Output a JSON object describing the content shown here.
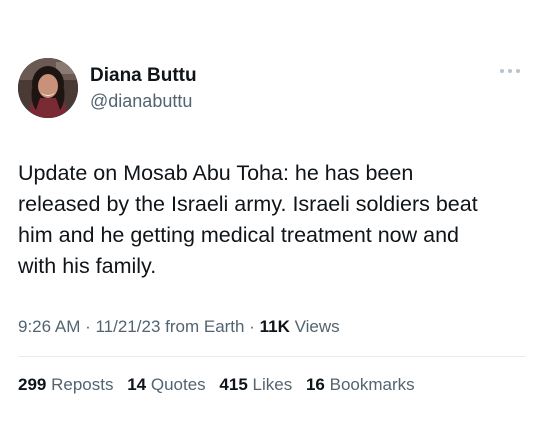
{
  "author": {
    "display_name": "Diana Buttu",
    "handle": "@dianabuttu",
    "avatar_icon": "profile-photo"
  },
  "more_icon": "more-options-icon",
  "tweet": {
    "text_lines": [
      "Update on Mosab Abu Toha: he has been",
      "released by the Israeli army. Israeli soldiers beat",
      "him and he getting medical treatment now and",
      "with his family."
    ]
  },
  "meta": {
    "time": "9:26 AM",
    "sep1": " · ",
    "date": "11/21/23",
    "source": " from Earth",
    "sep2": " · ",
    "views_count": "11K",
    "views_label": " Views"
  },
  "stats": {
    "reposts_count": "299",
    "reposts_label": "Reposts",
    "quotes_count": "14",
    "quotes_label": "Quotes",
    "likes_count": "415",
    "likes_label": "Likes",
    "bookmarks_count": "16",
    "bookmarks_label": "Bookmarks"
  },
  "colors": {
    "text_primary": "#0f1419",
    "text_secondary": "#536471",
    "divider": "#e8ecef",
    "background": "#ffffff"
  }
}
